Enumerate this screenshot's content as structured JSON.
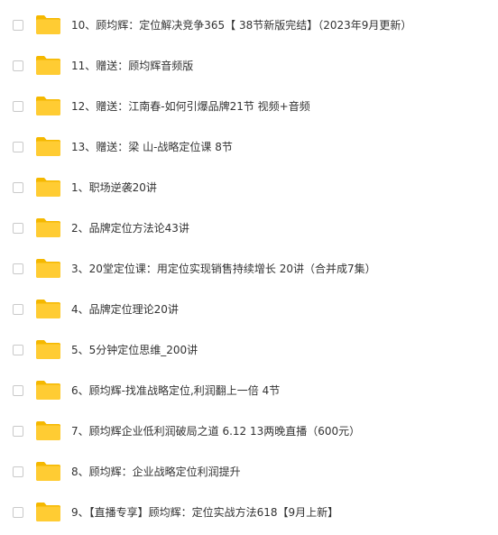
{
  "colors": {
    "folder_fill": "#FFCC33",
    "folder_tab": "#F5B800",
    "text": "#333333",
    "checkbox_border": "#c9c9c9"
  },
  "files": [
    {
      "icon": "folder-icon",
      "name": "10、顾均辉：定位解决竞争365【 38节新版完结】（2023年9月更新）"
    },
    {
      "icon": "folder-icon",
      "name": "11、赠送：顾均辉音频版"
    },
    {
      "icon": "folder-icon",
      "name": "12、赠送：江南春-如何引爆品牌21节 视频+音频"
    },
    {
      "icon": "folder-icon",
      "name": "13、赠送：梁 山-战略定位课 8节"
    },
    {
      "icon": "folder-icon",
      "name": "1、职场逆袭20讲"
    },
    {
      "icon": "folder-icon",
      "name": "2、品牌定位方法论43讲"
    },
    {
      "icon": "folder-icon",
      "name": "3、20堂定位课：用定位实现销售持续增长 20讲（合并成7集）"
    },
    {
      "icon": "folder-icon",
      "name": "4、品牌定位理论20讲"
    },
    {
      "icon": "folder-icon",
      "name": "5、5分钟定位思维_200讲"
    },
    {
      "icon": "folder-icon",
      "name": "6、顾均辉-找准战略定位,利润翻上一倍 4节"
    },
    {
      "icon": "folder-icon",
      "name": "7、顾均辉企业低利润破局之道 6.12 13两晚直播（600元）"
    },
    {
      "icon": "folder-icon",
      "name": "8、顾均辉：企业战略定位利润提升"
    },
    {
      "icon": "folder-icon",
      "name": "9、【直播专享】顾均辉：定位实战方法618【9月上新】"
    }
  ]
}
